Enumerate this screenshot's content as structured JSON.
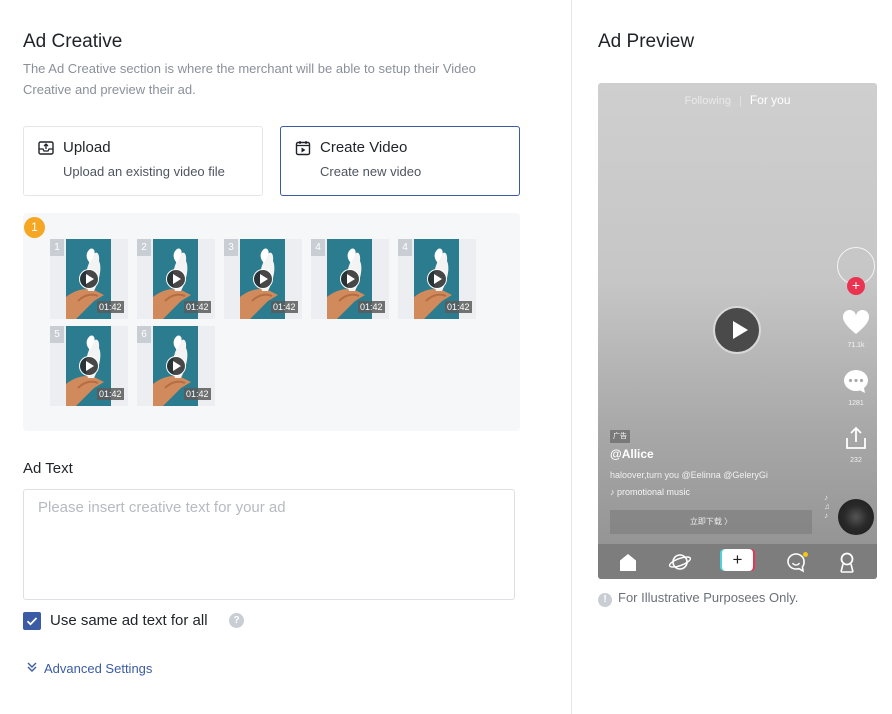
{
  "creative": {
    "title": "Ad Creative",
    "description": "The Ad Creative section is where the merchant will be able to setup their Video Creative and preview their ad.",
    "options": [
      {
        "icon": "upload-icon",
        "title": "Upload",
        "subtitle": "Upload an existing video file",
        "selected": false
      },
      {
        "icon": "video-calendar-icon",
        "title": "Create Video",
        "subtitle": "Create new video",
        "selected": true
      }
    ],
    "accent_color": "#3b5ba5"
  },
  "videos": {
    "badge": "1",
    "items": [
      {
        "num": "1",
        "duration": "01:42"
      },
      {
        "num": "2",
        "duration": "01:42"
      },
      {
        "num": "3",
        "duration": "01:42"
      },
      {
        "num": "4",
        "duration": "01:42"
      },
      {
        "num": "4",
        "duration": "01:42"
      },
      {
        "num": "5",
        "duration": "01:42"
      },
      {
        "num": "6",
        "duration": "01:42"
      }
    ]
  },
  "ad_text": {
    "label": "Ad Text",
    "placeholder": "Please insert creative text for your ad",
    "value": "",
    "same_text_label": "Use same ad text for all",
    "same_text_checked": true,
    "help": "?",
    "advanced_label": "Advanced Settings"
  },
  "preview": {
    "title": "Ad Preview",
    "tab_following": "Following",
    "tab_for_you": "For you",
    "likes": "71.1k",
    "comments": "1281",
    "shares": "232",
    "ad_tag": "广告",
    "handle": "@Allice",
    "caption": "haloover,turn you @Eelinna @GeleryGi",
    "music": "promotional music",
    "cta": "立即下载 〉",
    "disclaimer": "For Illustrative Purposees Only."
  }
}
